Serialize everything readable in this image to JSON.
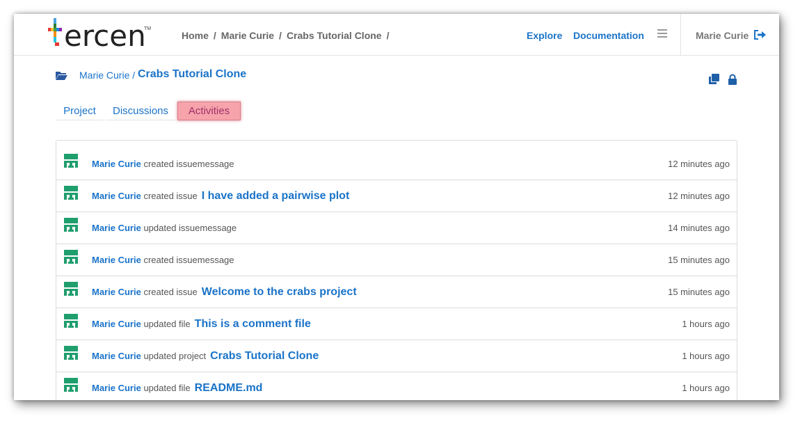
{
  "header": {
    "logo_text": "ercen",
    "logo_tm": "TM",
    "breadcrumb": [
      "Home",
      "Marie Curie",
      "Crabs Tutorial Clone"
    ],
    "breadcrumb_sep": "/",
    "explore": "Explore",
    "documentation": "Documentation",
    "user": "Marie Curie"
  },
  "project": {
    "owner": "Marie Curie /",
    "name": "Crabs Tutorial Clone"
  },
  "tabs": [
    "Project",
    "Discussions",
    "Activities"
  ],
  "activities": [
    {
      "who": "Marie Curie",
      "action": "created issuemessage",
      "object": "",
      "when": "12 minutes ago"
    },
    {
      "who": "Marie Curie",
      "action": "created issue",
      "object": "I have added a pairwise plot",
      "when": "12 minutes ago"
    },
    {
      "who": "Marie Curie",
      "action": "updated issuemessage",
      "object": "",
      "when": "14 minutes ago"
    },
    {
      "who": "Marie Curie",
      "action": "created issuemessage",
      "object": "",
      "when": "15 minutes ago"
    },
    {
      "who": "Marie Curie",
      "action": "created issue",
      "object": "Welcome to the crabs project",
      "when": "15 minutes ago"
    },
    {
      "who": "Marie Curie",
      "action": "updated file",
      "object": "This is a comment file",
      "when": "1 hours ago"
    },
    {
      "who": "Marie Curie",
      "action": "updated project",
      "object": "Crabs Tutorial Clone",
      "when": "1 hours ago"
    },
    {
      "who": "Marie Curie",
      "action": "updated file",
      "object": "README.md",
      "when": "1 hours ago"
    }
  ],
  "colors": {
    "link": "#1a73c8",
    "active_tab_bg": "#f6a3ab",
    "avatar": "#1f9e6e"
  }
}
